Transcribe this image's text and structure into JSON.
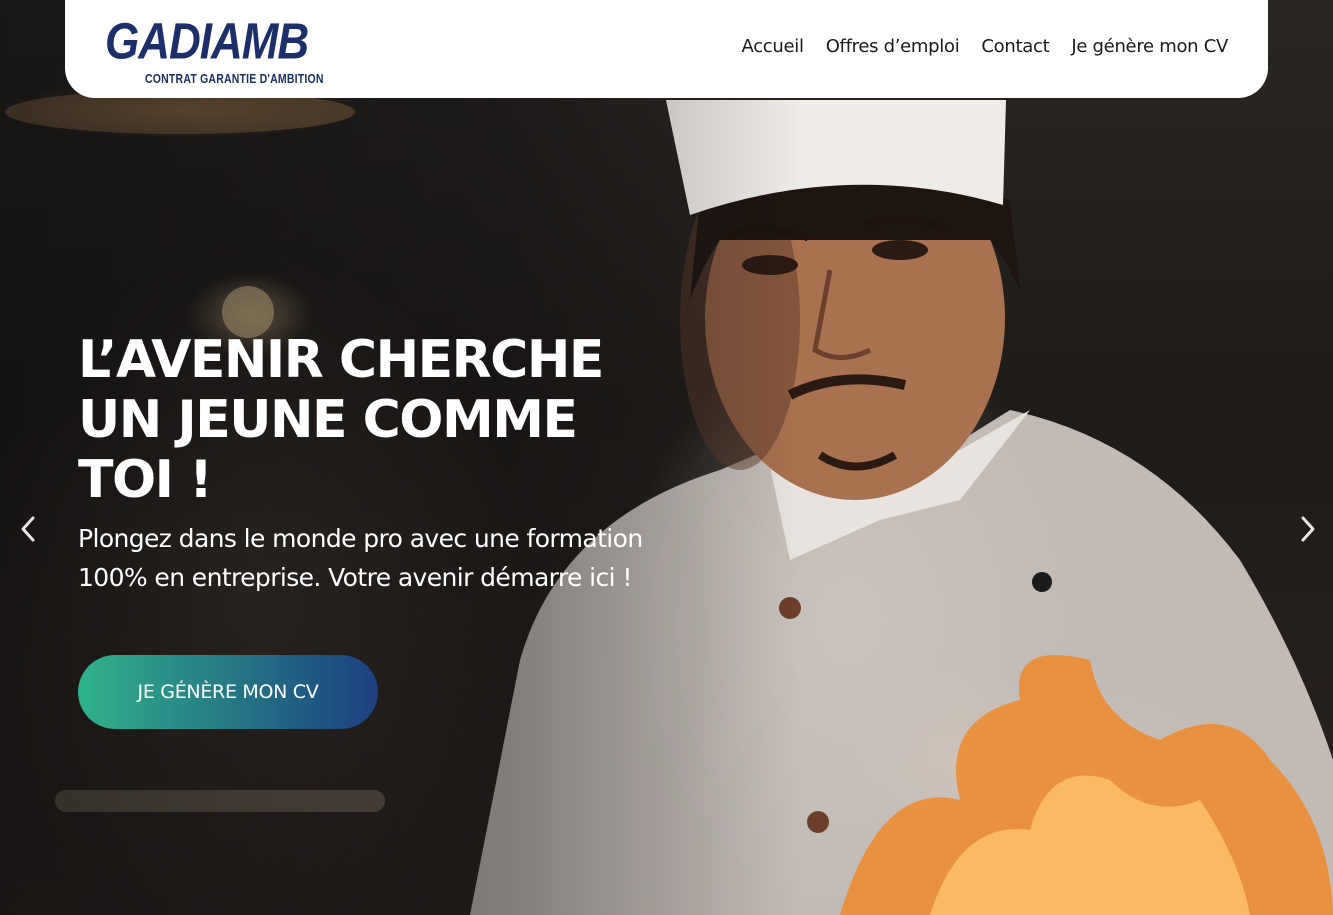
{
  "brand": {
    "name": "GADIAMB",
    "tagline": "CONTRAT GARANTIE D'AMBITION",
    "color": "#1d2f6b"
  },
  "nav": {
    "items": [
      {
        "label": "Accueil"
      },
      {
        "label": "Offres d’emploi"
      },
      {
        "label": "Contact"
      },
      {
        "label": "Je génère mon CV"
      }
    ]
  },
  "hero": {
    "headline": "L’AVENIR CHERCHE UN JEUNE COMME TOI !",
    "subtext": "Plongez dans le monde pro avec une formation 100% en entreprise. Votre avenir démarre ici !",
    "cta_label": "JE GÉNÈRE MON CV",
    "cta_gradient": [
      "#2fb38b",
      "#1d3f80"
    ],
    "prev_icon": "chevron-left-icon",
    "next_icon": "chevron-right-icon"
  }
}
